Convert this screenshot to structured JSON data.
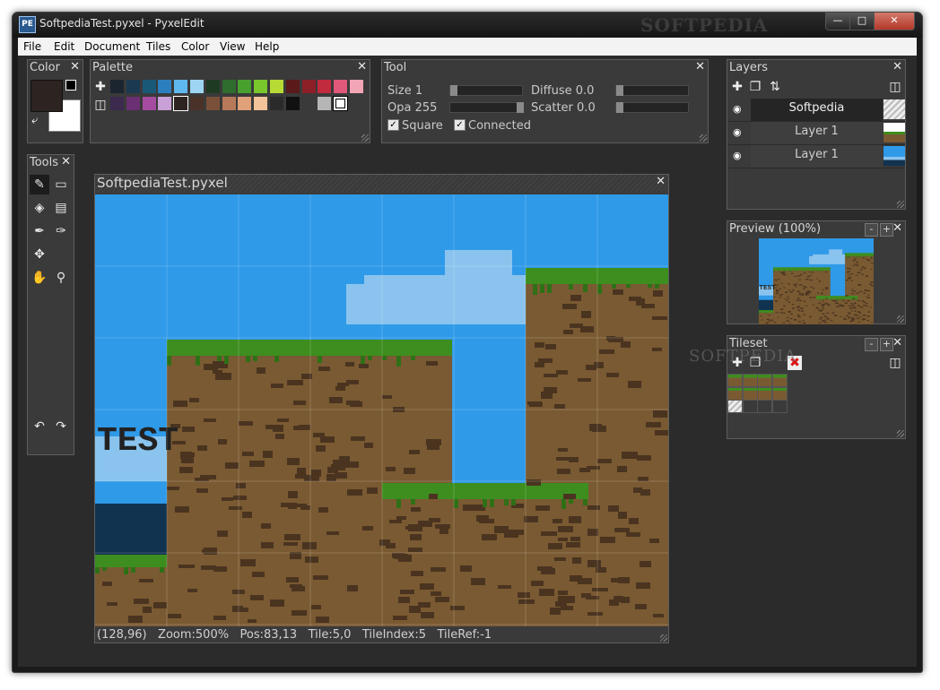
{
  "window": {
    "title": "SoftpediaTest.pyxel - PyxelEdit",
    "icon_text": "PE",
    "watermark": "SOFTPEDIA",
    "min_icon": "minimize-icon",
    "max_icon": "maximize-icon",
    "close_icon": "close-icon"
  },
  "menu": [
    "File",
    "Edit",
    "Document",
    "Tiles",
    "Color",
    "View",
    "Help"
  ],
  "color_panel": {
    "title": "Color",
    "primary": "#2d2320",
    "secondary": "#ffffff"
  },
  "palette_panel": {
    "title": "Palette",
    "row1": [
      "#1b2530",
      "#1b3a52",
      "#1a5878",
      "#2c7fbf",
      "#5eb8ee",
      "#9dd5f2",
      "#1f3a22",
      "#2e6d2e",
      "#48a02f",
      "#78c62b",
      "#b7da35",
      "#5a1a1a",
      "#8c1f27",
      "#c22a3d",
      "#e0587a",
      "#f2a5b5"
    ],
    "row2": [
      "#3c2a4f",
      "#6b2f73",
      "#a54ca0",
      "#c9a0d8",
      "#2d2320",
      "#4a3228",
      "#7a5038",
      "#b8795a",
      "#e0a07a",
      "#f3c49a",
      "#2b2b2b",
      "#111111",
      "#3a3a3a",
      "#b6b6b6",
      "#ffffff"
    ]
  },
  "tool_panel": {
    "title": "Tool",
    "size_label": "Size 1",
    "size_value": 0.0,
    "opacity_label": "Opa 255",
    "opacity_value": 1.0,
    "diffuse_label": "Diffuse 0.0",
    "diffuse_value": 0.0,
    "scatter_label": "Scatter 0.0",
    "scatter_value": 0.0,
    "square_label": "Square",
    "square_checked": true,
    "connected_label": "Connected",
    "connected_checked": true
  },
  "tools_panel": {
    "title": "Tools",
    "icons": [
      "pencil-icon",
      "eraser-icon",
      "fill-bucket-icon",
      "rectangle-select-icon",
      "color-picker-icon",
      "brush-icon",
      "move-icon",
      "hand-icon",
      "zoom-icon",
      "undo-icon",
      "redo-icon"
    ]
  },
  "canvas": {
    "title": "SoftpediaTest.pyxel",
    "text_art": "TEST",
    "status": [
      "(128,96)",
      "Zoom:500%",
      "Pos:83,13",
      "Tile:5,0",
      "TileIndex:5",
      "TileRef:-1"
    ]
  },
  "layers_panel": {
    "title": "Layers",
    "layers": [
      {
        "name": "Softpedia",
        "visible": true,
        "active": true
      },
      {
        "name": "Layer 1",
        "visible": true,
        "active": false
      },
      {
        "name": "Layer 1",
        "visible": true,
        "active": false
      }
    ]
  },
  "preview_panel": {
    "title": "Preview (100%)",
    "minus": "-",
    "plus": "+"
  },
  "tileset_panel": {
    "title": "Tileset",
    "minus": "-",
    "plus": "+"
  },
  "colors": {
    "sky": "#2f9ae8",
    "cloud": "#8ac4ee",
    "dirt": "#7a5a32",
    "dirt_dark": "#4a3420",
    "grass": "#3d8e1f",
    "water": "#123350"
  }
}
